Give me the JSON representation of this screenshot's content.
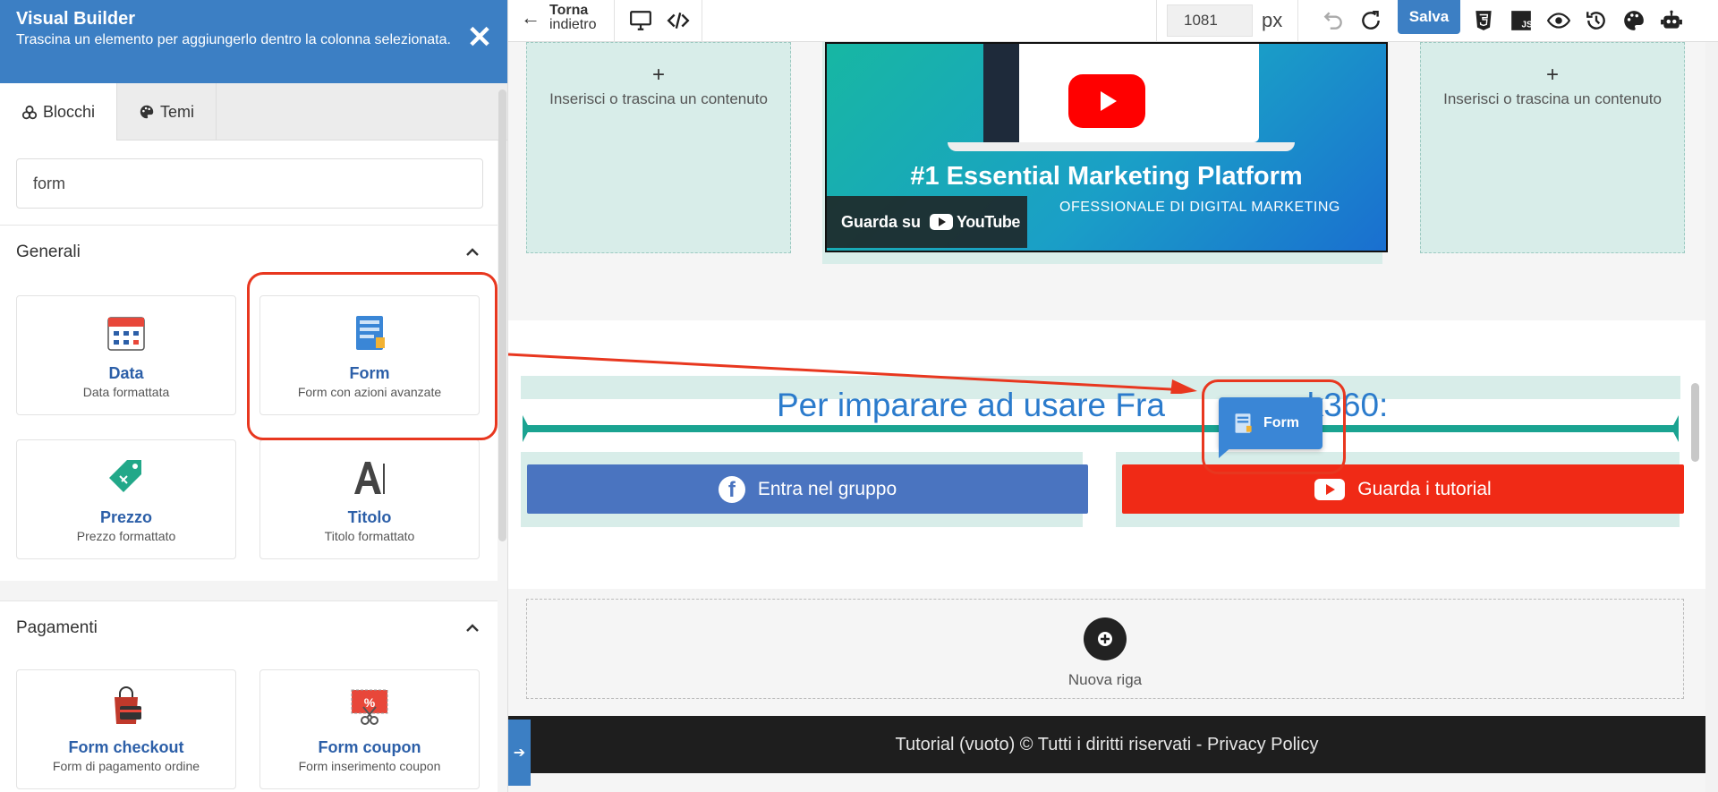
{
  "sidebar": {
    "title": "Visual Builder",
    "subtitle": "Trascina un elemento per aggiungerlo dentro la colonna selezionata.",
    "close_icon": "close-icon",
    "tabs": [
      {
        "label": "Blocchi",
        "icon": "blocks-icon",
        "active": true
      },
      {
        "label": "Temi",
        "icon": "palette-icon",
        "active": false
      }
    ],
    "search_value": "form",
    "sections": [
      {
        "title": "Generali",
        "cards": [
          {
            "name": "Data",
            "desc": "Data formattata",
            "icon": "calendar-icon"
          },
          {
            "name": "Form",
            "desc": "Form con azioni avanzate",
            "icon": "form-icon"
          },
          {
            "name": "Prezzo",
            "desc": "Prezzo formattato",
            "icon": "price-tag-icon"
          },
          {
            "name": "Titolo",
            "desc": "Titolo formattato",
            "icon": "title-icon"
          }
        ]
      },
      {
        "title": "Pagamenti",
        "cards": [
          {
            "name": "Form checkout",
            "desc": "Form di pagamento ordine",
            "icon": "checkout-icon"
          },
          {
            "name": "Form coupon",
            "desc": "Form inserimento coupon",
            "icon": "coupon-icon"
          }
        ]
      }
    ]
  },
  "topbar": {
    "back_label_1": "Torna",
    "back_label_2": "indietro",
    "width_value": "1081",
    "width_unit": "px",
    "save_label": "Salva"
  },
  "canvas": {
    "drop_plus": "+",
    "drop_text": "Inserisci o trascina un contenuto",
    "video": {
      "title": "#1 Essential Marketing Platform",
      "subtitle": "OFESSIONALE DI DIGITAL MARKETING",
      "watch_label": "Guarda su",
      "yt_brand": "YouTube"
    },
    "heading": "Per imparare ad usare Fra",
    "heading_tail": "ork360:",
    "buttons": [
      {
        "label": "Entra nel gruppo",
        "icon": "facebook-icon"
      },
      {
        "label": "Guarda i tutorial",
        "icon": "youtube-icon"
      }
    ],
    "drag_ghost_label": "Form",
    "new_row_label": "Nuova riga",
    "footer_text": "Tutorial (vuoto) © Tutti i diritti riservati - Privacy Policy"
  },
  "colors": {
    "accent": "#3c7fc4",
    "highlight": "#e8371f",
    "teal": "#1aa391",
    "facebook": "#4a74c0",
    "youtube": "#f02a16"
  }
}
